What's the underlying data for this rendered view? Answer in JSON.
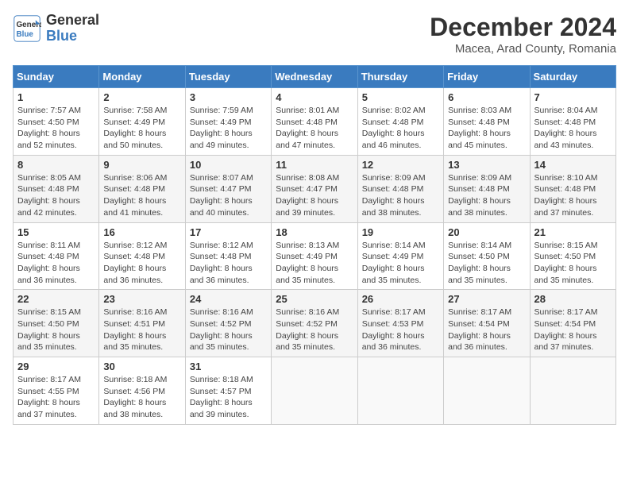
{
  "header": {
    "logo_general": "General",
    "logo_blue": "Blue",
    "month_title": "December 2024",
    "location": "Macea, Arad County, Romania"
  },
  "weekdays": [
    "Sunday",
    "Monday",
    "Tuesday",
    "Wednesday",
    "Thursday",
    "Friday",
    "Saturday"
  ],
  "weeks": [
    [
      {
        "day": "1",
        "info": "Sunrise: 7:57 AM\nSunset: 4:50 PM\nDaylight: 8 hours\nand 52 minutes."
      },
      {
        "day": "2",
        "info": "Sunrise: 7:58 AM\nSunset: 4:49 PM\nDaylight: 8 hours\nand 50 minutes."
      },
      {
        "day": "3",
        "info": "Sunrise: 7:59 AM\nSunset: 4:49 PM\nDaylight: 8 hours\nand 49 minutes."
      },
      {
        "day": "4",
        "info": "Sunrise: 8:01 AM\nSunset: 4:48 PM\nDaylight: 8 hours\nand 47 minutes."
      },
      {
        "day": "5",
        "info": "Sunrise: 8:02 AM\nSunset: 4:48 PM\nDaylight: 8 hours\nand 46 minutes."
      },
      {
        "day": "6",
        "info": "Sunrise: 8:03 AM\nSunset: 4:48 PM\nDaylight: 8 hours\nand 45 minutes."
      },
      {
        "day": "7",
        "info": "Sunrise: 8:04 AM\nSunset: 4:48 PM\nDaylight: 8 hours\nand 43 minutes."
      }
    ],
    [
      {
        "day": "8",
        "info": "Sunrise: 8:05 AM\nSunset: 4:48 PM\nDaylight: 8 hours\nand 42 minutes."
      },
      {
        "day": "9",
        "info": "Sunrise: 8:06 AM\nSunset: 4:48 PM\nDaylight: 8 hours\nand 41 minutes."
      },
      {
        "day": "10",
        "info": "Sunrise: 8:07 AM\nSunset: 4:47 PM\nDaylight: 8 hours\nand 40 minutes."
      },
      {
        "day": "11",
        "info": "Sunrise: 8:08 AM\nSunset: 4:47 PM\nDaylight: 8 hours\nand 39 minutes."
      },
      {
        "day": "12",
        "info": "Sunrise: 8:09 AM\nSunset: 4:48 PM\nDaylight: 8 hours\nand 38 minutes."
      },
      {
        "day": "13",
        "info": "Sunrise: 8:09 AM\nSunset: 4:48 PM\nDaylight: 8 hours\nand 38 minutes."
      },
      {
        "day": "14",
        "info": "Sunrise: 8:10 AM\nSunset: 4:48 PM\nDaylight: 8 hours\nand 37 minutes."
      }
    ],
    [
      {
        "day": "15",
        "info": "Sunrise: 8:11 AM\nSunset: 4:48 PM\nDaylight: 8 hours\nand 36 minutes."
      },
      {
        "day": "16",
        "info": "Sunrise: 8:12 AM\nSunset: 4:48 PM\nDaylight: 8 hours\nand 36 minutes."
      },
      {
        "day": "17",
        "info": "Sunrise: 8:12 AM\nSunset: 4:48 PM\nDaylight: 8 hours\nand 36 minutes."
      },
      {
        "day": "18",
        "info": "Sunrise: 8:13 AM\nSunset: 4:49 PM\nDaylight: 8 hours\nand 35 minutes."
      },
      {
        "day": "19",
        "info": "Sunrise: 8:14 AM\nSunset: 4:49 PM\nDaylight: 8 hours\nand 35 minutes."
      },
      {
        "day": "20",
        "info": "Sunrise: 8:14 AM\nSunset: 4:50 PM\nDaylight: 8 hours\nand 35 minutes."
      },
      {
        "day": "21",
        "info": "Sunrise: 8:15 AM\nSunset: 4:50 PM\nDaylight: 8 hours\nand 35 minutes."
      }
    ],
    [
      {
        "day": "22",
        "info": "Sunrise: 8:15 AM\nSunset: 4:50 PM\nDaylight: 8 hours\nand 35 minutes."
      },
      {
        "day": "23",
        "info": "Sunrise: 8:16 AM\nSunset: 4:51 PM\nDaylight: 8 hours\nand 35 minutes."
      },
      {
        "day": "24",
        "info": "Sunrise: 8:16 AM\nSunset: 4:52 PM\nDaylight: 8 hours\nand 35 minutes."
      },
      {
        "day": "25",
        "info": "Sunrise: 8:16 AM\nSunset: 4:52 PM\nDaylight: 8 hours\nand 35 minutes."
      },
      {
        "day": "26",
        "info": "Sunrise: 8:17 AM\nSunset: 4:53 PM\nDaylight: 8 hours\nand 36 minutes."
      },
      {
        "day": "27",
        "info": "Sunrise: 8:17 AM\nSunset: 4:54 PM\nDaylight: 8 hours\nand 36 minutes."
      },
      {
        "day": "28",
        "info": "Sunrise: 8:17 AM\nSunset: 4:54 PM\nDaylight: 8 hours\nand 37 minutes."
      }
    ],
    [
      {
        "day": "29",
        "info": "Sunrise: 8:17 AM\nSunset: 4:55 PM\nDaylight: 8 hours\nand 37 minutes."
      },
      {
        "day": "30",
        "info": "Sunrise: 8:18 AM\nSunset: 4:56 PM\nDaylight: 8 hours\nand 38 minutes."
      },
      {
        "day": "31",
        "info": "Sunrise: 8:18 AM\nSunset: 4:57 PM\nDaylight: 8 hours\nand 39 minutes."
      },
      {
        "day": "",
        "info": ""
      },
      {
        "day": "",
        "info": ""
      },
      {
        "day": "",
        "info": ""
      },
      {
        "day": "",
        "info": ""
      }
    ]
  ]
}
